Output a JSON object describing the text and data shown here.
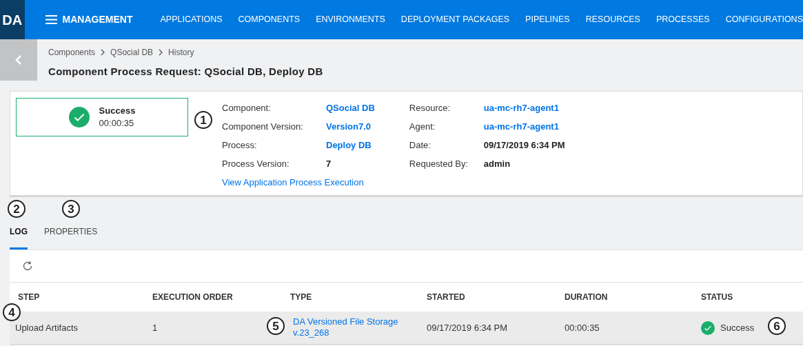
{
  "header": {
    "logo": "DA",
    "section": "MANAGEMENT",
    "nav": [
      {
        "label": "APPLICATIONS",
        "selected": false
      },
      {
        "label": "COMPONENTS",
        "selected": false
      },
      {
        "label": "ENVIRONMENTS",
        "selected": false
      },
      {
        "label": "DEPLOYMENT PACKAGES",
        "selected": false
      },
      {
        "label": "PIPELINES",
        "selected": false
      },
      {
        "label": "RESOURCES",
        "selected": false
      },
      {
        "label": "PROCESSES",
        "selected": false
      },
      {
        "label": "CONFIGURATIONS",
        "selected": false
      }
    ]
  },
  "breadcrumbs": [
    "Components",
    "QSocial DB",
    "History"
  ],
  "title": "Component Process Request: QSocial DB, Deploy DB",
  "summary": {
    "status": "Success",
    "duration": "00:00:35",
    "left_fields": [
      {
        "label": "Component:",
        "value": "QSocial DB",
        "kind": "link"
      },
      {
        "label": "Component Version:",
        "value": "Version7.0",
        "kind": "link"
      },
      {
        "label": "Process:",
        "value": "Deploy DB",
        "kind": "link"
      },
      {
        "label": "Process Version:",
        "value": "7",
        "kind": "text"
      }
    ],
    "link": "View Application Process Execution",
    "right_fields": [
      {
        "label": "Resource:",
        "value": "ua-mc-rh7-agent1",
        "kind": "link"
      },
      {
        "label": "Agent:",
        "value": "ua-mc-rh7-agent1",
        "kind": "link"
      },
      {
        "label": "Date:",
        "value": "09/17/2019 6:34 PM",
        "kind": "text"
      },
      {
        "label": "Requested By:",
        "value": "admin",
        "kind": "text"
      }
    ]
  },
  "tabs": [
    {
      "label": "LOG",
      "selected": true
    },
    {
      "label": "PROPERTIES",
      "selected": false
    }
  ],
  "table": {
    "columns": [
      "STEP",
      "EXECUTION ORDER",
      "TYPE",
      "STARTED",
      "DURATION",
      "STATUS"
    ],
    "rows": [
      {
        "step": "Upload Artifacts",
        "order": "1",
        "type": [
          "DA Versioned File Storage",
          "v.23_268"
        ],
        "started": "09/17/2019 6:34 PM",
        "duration": "00:00:35",
        "status": "Success"
      }
    ]
  },
  "callouts": [
    "1",
    "2",
    "3",
    "4",
    "5",
    "6"
  ]
}
